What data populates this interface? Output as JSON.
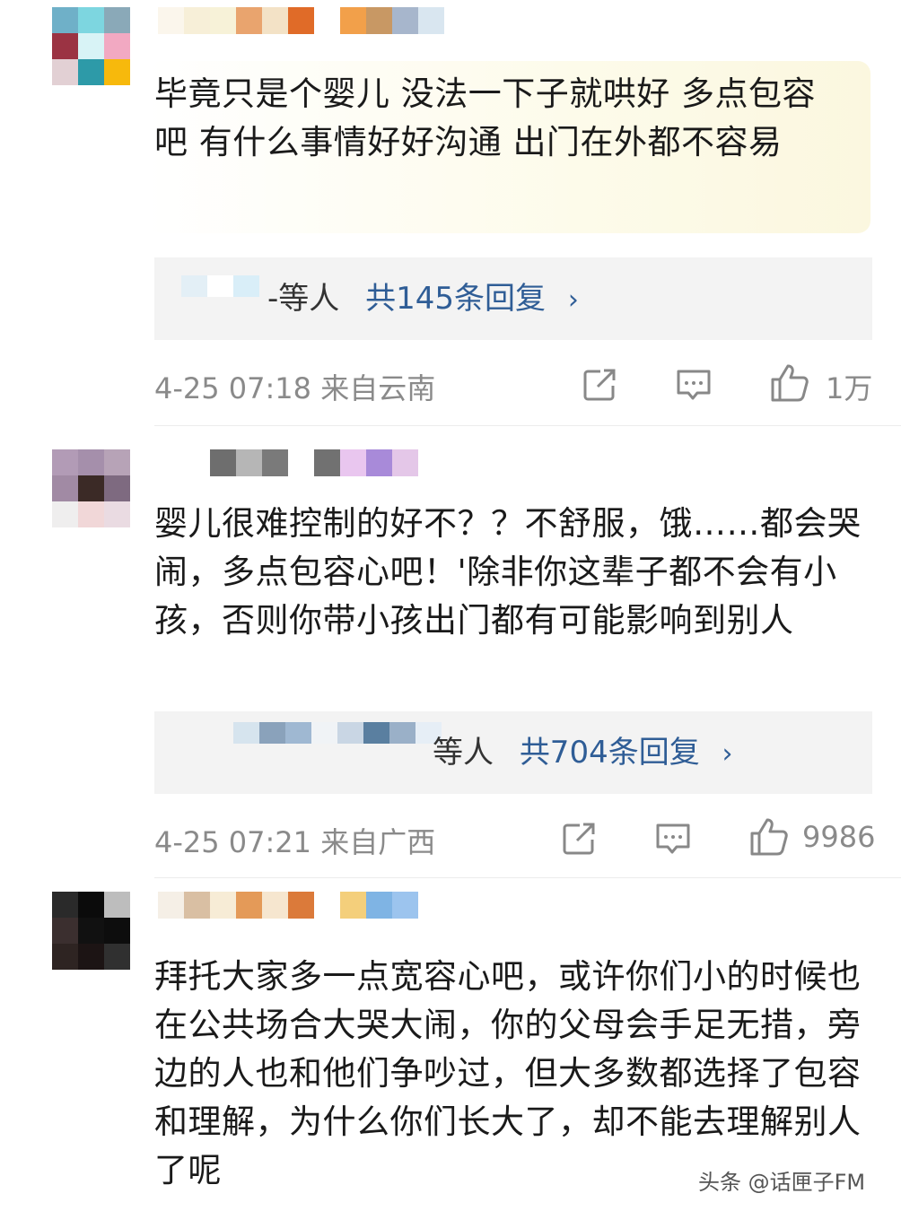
{
  "comments": [
    {
      "text": "毕竟只是个婴儿  没法一下子就哄好  多点包容吧  有什么事情好好沟通  出门在外都不容易",
      "reply_people": "-等人",
      "reply_count": "共145条回复",
      "time_location": "4-25 07:18 来自云南",
      "likes": "1万"
    },
    {
      "text": "婴儿很难控制的好不？？不舒服，饿……都会哭闹，多点包容心吧！'除非你这辈子都不会有小孩，否则你带小孩出门都有可能影响到别人",
      "reply_people": "等人",
      "reply_count": "共704条回复",
      "time_location": "4-25 07:21 来自广西",
      "likes": "9986"
    },
    {
      "text": "拜托大家多一点宽容心吧，或许你们小的时候也在公共场合大哭大闹，你的父母会手足无措，旁边的人也和他们争吵过，但大多数都选择了包容和理解，为什么你们长大了，却不能去理解别人了呢"
    }
  ],
  "icons": {
    "share": "share-icon",
    "comment": "comment-icon",
    "like": "thumbs-up-icon",
    "chevron": "chevron-right-icon"
  },
  "watermark": "头条 @话匣子FM",
  "colors": {
    "link_blue": "#2f5d96",
    "meta_gray": "#8a8a8a",
    "reply_bg": "#f3f3f3",
    "highlight": "#fbf7df"
  }
}
